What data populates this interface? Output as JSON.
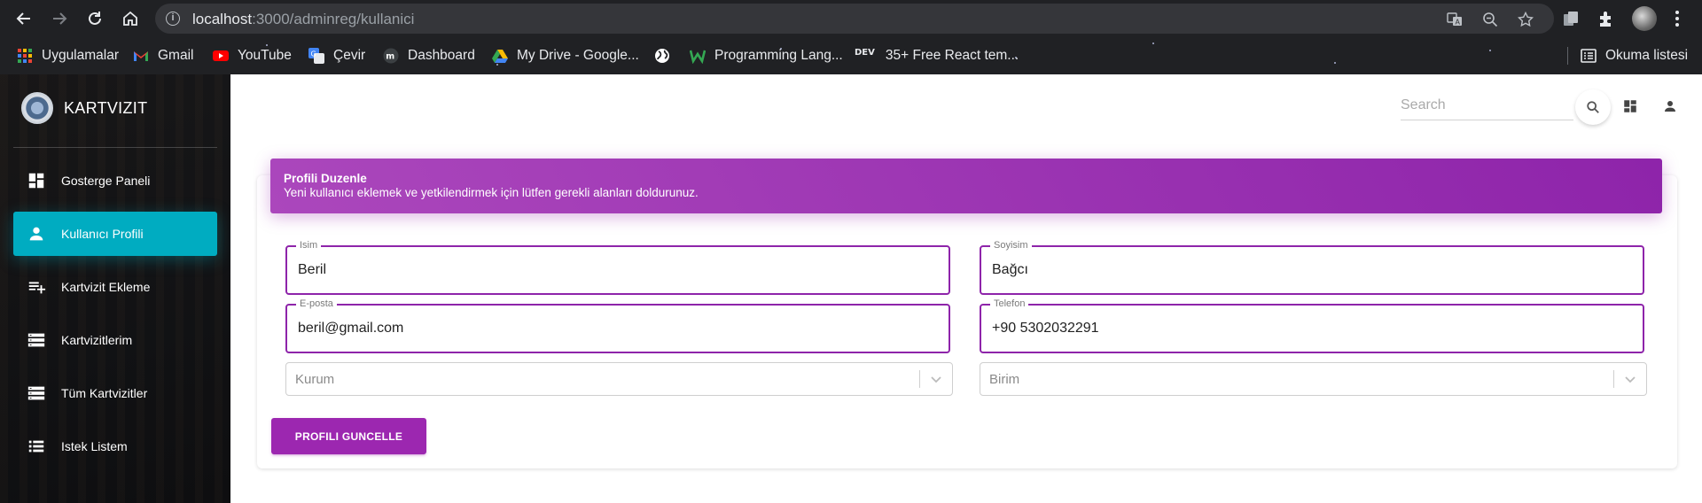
{
  "browser": {
    "url_host": "localhost",
    "url_rest": ":3000/adminreg/kullanici",
    "bookmarks": [
      {
        "label": "Uygulamalar",
        "icon": "apps-grid-icon"
      },
      {
        "label": "Gmail",
        "icon": "gmail-icon"
      },
      {
        "label": "YouTube",
        "icon": "youtube-icon"
      },
      {
        "label": "Çevir",
        "icon": "translate-icon"
      },
      {
        "label": "Dashboard",
        "icon": "dashboard-site-icon"
      },
      {
        "label": "My Drive - Google...",
        "icon": "google-drive-icon"
      },
      {
        "label": "",
        "icon": "globe-icon"
      },
      {
        "label": "Programming Lang...",
        "icon": "w-site-icon"
      },
      {
        "label": "35+ Free React tem...",
        "icon": "dev-icon"
      }
    ],
    "reading_list": "Okuma listesi",
    "dev_badge": "DEV"
  },
  "sidebar": {
    "brand": "KARTVIZIT",
    "items": [
      {
        "label": "Gosterge Paneli",
        "icon": "dashboard-icon",
        "active": false
      },
      {
        "label": "Kullanıcı Profili",
        "icon": "person-icon",
        "active": true
      },
      {
        "label": "Kartvizit Ekleme",
        "icon": "playlist-add-icon",
        "active": false
      },
      {
        "label": "Kartvizitlerim",
        "icon": "storage-icon",
        "active": false
      },
      {
        "label": "Tüm Kartvizitler",
        "icon": "storage-icon",
        "active": false
      },
      {
        "label": "Istek Listem",
        "icon": "list-icon",
        "active": false
      }
    ]
  },
  "topbar": {
    "search_placeholder": "Search"
  },
  "form": {
    "header_title": "Profili Duzenle",
    "header_subtitle": "Yeni kullanıcı eklemek ve yetkilendirmek için lütfen gerekli alanları doldurunuz.",
    "first_name": {
      "label": "Isim",
      "value": "Beril"
    },
    "last_name": {
      "label": "Soyisim",
      "value": "Bağcı"
    },
    "email": {
      "label": "E-posta",
      "value": "beril@gmail.com"
    },
    "phone": {
      "label": "Telefon",
      "value": "+90 5302032291"
    },
    "institution": {
      "placeholder": "Kurum"
    },
    "unit": {
      "placeholder": "Birim"
    },
    "submit_label": "PROFILI GUNCELLE"
  },
  "colors": {
    "accent_purple": "#9c27b0",
    "active_cyan": "#00acc1",
    "chrome_bg": "#202124"
  }
}
